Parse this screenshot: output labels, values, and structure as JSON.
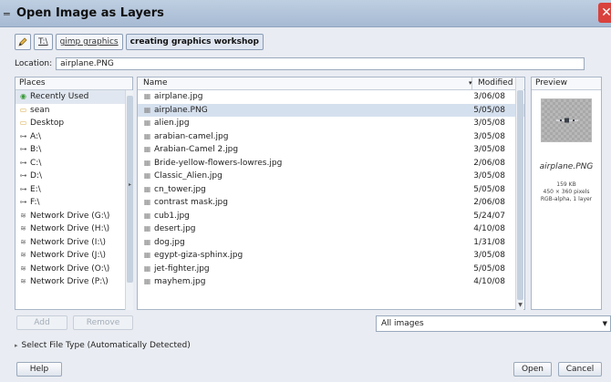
{
  "window": {
    "title": "Open Image as Layers",
    "close_label": "✕"
  },
  "path_bar": {
    "crumbs": [
      "T:\\",
      "gimp graphics",
      "creating graphics workshop"
    ]
  },
  "location": {
    "label": "Location:",
    "value": "airplane.PNG"
  },
  "places": {
    "header": "Places",
    "items": [
      "Recently Used",
      "sean",
      "Desktop",
      "A:\\",
      "B:\\",
      "C:\\",
      "D:\\",
      "E:\\",
      "F:\\",
      "Network Drive (G:\\)",
      "Network Drive (H:\\)",
      "Network Drive (I:\\)",
      "Network Drive (J:\\)",
      "Network Drive (O:\\)",
      "Network Drive (P:\\)"
    ]
  },
  "files": {
    "header_name": "Name",
    "header_modified": "Modified",
    "rows": [
      {
        "name": "airplane.jpg",
        "modified": "3/06/08"
      },
      {
        "name": "airplane.PNG",
        "modified": "5/05/08"
      },
      {
        "name": "alien.jpg",
        "modified": "3/05/08"
      },
      {
        "name": "arabian-camel.jpg",
        "modified": "3/05/08"
      },
      {
        "name": "Arabian-Camel 2.jpg",
        "modified": "3/05/08"
      },
      {
        "name": "Bride-yellow-flowers-lowres.jpg",
        "modified": "2/06/08"
      },
      {
        "name": "Classic_Alien.jpg",
        "modified": "3/05/08"
      },
      {
        "name": "cn_tower.jpg",
        "modified": "5/05/08"
      },
      {
        "name": "contrast mask.jpg",
        "modified": "2/06/08"
      },
      {
        "name": "cub1.jpg",
        "modified": "5/24/07"
      },
      {
        "name": "desert.jpg",
        "modified": "4/10/08"
      },
      {
        "name": "dog.jpg",
        "modified": "1/31/08"
      },
      {
        "name": "egypt-giza-sphinx.jpg",
        "modified": "3/05/08"
      },
      {
        "name": "jet-fighter.jpg",
        "modified": "5/05/08"
      },
      {
        "name": "mayhem.jpg",
        "modified": "4/10/08"
      }
    ],
    "selected_index": 1
  },
  "preview": {
    "header": "Preview",
    "filename": "airplane.PNG",
    "size": "159 KB",
    "dimensions": "450 × 360 pixels",
    "mode": "RGB-alpha, 1 layer"
  },
  "buttons": {
    "add": "Add",
    "remove": "Remove",
    "help": "Help",
    "open": "Open",
    "cancel": "Cancel"
  },
  "filter": {
    "value": "All images"
  },
  "file_type": {
    "label": "Select File Type (Automatically Detected)"
  },
  "icons": {
    "edit": "pencil-icon",
    "folder": "folder-icon",
    "drive": "drive-icon",
    "network": "network-drive-icon",
    "recent": "recent-icon",
    "image": "image-file-icon"
  },
  "colors": {
    "selection": "#d5e0ee",
    "titlebar": "#a6bad3",
    "close": "#d9413c"
  }
}
